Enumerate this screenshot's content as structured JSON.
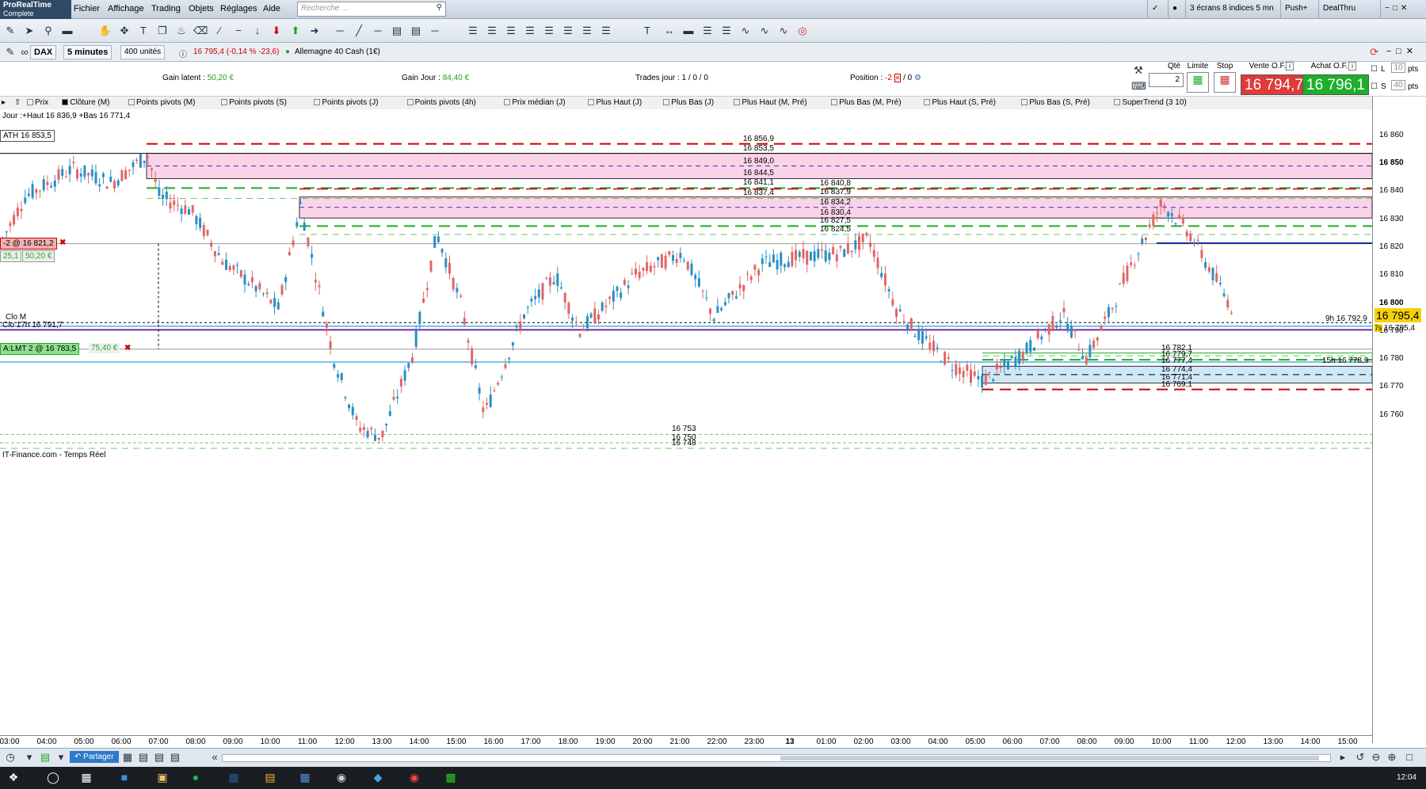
{
  "app": {
    "logo": "ProRealTime",
    "logo_sub": "Complete"
  },
  "menu": [
    "Fichier",
    "Affichage",
    "Trading",
    "Objets",
    "Réglages",
    "Aide"
  ],
  "search": {
    "placeholder": "Recherche ..."
  },
  "right_menu": {
    "layout": "3 écrans 8 indices 5 mn",
    "pushplus": "Push+",
    "dealthru": "DealThru"
  },
  "chart_bar": {
    "instrument": "DAX",
    "period": "5 minutes",
    "units": "400 unités",
    "quote": "16 795,4 (-0,14 % -23,6)",
    "market": "Allemagne 40 Cash (1€)"
  },
  "info": {
    "gain_latent_label": "Gain latent :",
    "gain_latent": "50,20 €",
    "gain_jour_label": "Gain Jour :",
    "gain_jour": "84,40 €",
    "trades_label": "Trades jour :",
    "trades": "1 / 0 / 0",
    "position_label": "Position :",
    "position": "-2",
    "position_extra": "/ 0"
  },
  "order": {
    "qte_label": "Qté",
    "qte": "2",
    "limite_label": "Limite",
    "stop_label": "Stop",
    "vente_label": "Vente O.F.",
    "vente": "16 794,7",
    "achat_label": "Achat O.F.",
    "achat": "16 796,1",
    "pts1": "10",
    "pts2": "40",
    "pts": "pts",
    "L": "L",
    "S": "S"
  },
  "indicators": [
    "Prix",
    "Clôture (M)",
    "Points pivots (M)",
    "Points pivots (S)",
    "Points pivots (J)",
    "Points pivots (4h)",
    "Prix médian (J)",
    "Plus Haut (J)",
    "Plus Bas (J)",
    "Plus Haut (M, Pré)",
    "Plus Bas (M, Pré)",
    "Plus Haut (S, Pré)",
    "Plus Bas (S, Pré)",
    "SuperTrend (3 10)"
  ],
  "chart_labels": {
    "jour": "Jour :+Haut 16 836,9 +Bas 16 771,4",
    "ath": "ATH 16 853,5",
    "position_tag": "-2 @ 16 821,2",
    "pos_pts": "25,1",
    "pos_gain": "50,20 €",
    "order_tag": "A:LMT 2 @ 16 783,5",
    "order_gain": "75,40 €",
    "clo_m": "Clo M",
    "clo_17h": "Clo 17h 16 791,7",
    "h9": "9h 16 792,9",
    "h15": "15h 16 778,9",
    "source": "IT-Finance.com - Temps Réel",
    "price_box": "16 795,4",
    "price_small": "16 795,4",
    "ts": "7s"
  },
  "levels": [
    {
      "v": "16 856,9"
    },
    {
      "v": "16 853,5"
    },
    {
      "v": "16 849,0"
    },
    {
      "v": "16 844,5"
    },
    {
      "v": "16 841,1"
    },
    {
      "v": "16 840,8"
    },
    {
      "v": "16 837,4"
    },
    {
      "v": "16 837,9"
    },
    {
      "v": "16 834,2"
    },
    {
      "v": "16 830,4"
    },
    {
      "v": "16 827,5"
    },
    {
      "v": "16 824,5"
    },
    {
      "v": "16 782,1"
    },
    {
      "v": "16 779,7"
    },
    {
      "v": "16 777,4"
    },
    {
      "v": "16 774,4"
    },
    {
      "v": "16 771,4"
    },
    {
      "v": "16 769,1"
    },
    {
      "v": "16 753"
    },
    {
      "v": "16 750"
    },
    {
      "v": "16 748"
    }
  ],
  "y_axis": [
    "16 860",
    "16 850",
    "16 840",
    "16 830",
    "16 820",
    "16 810",
    "16 800",
    "16 790",
    "16 780",
    "16 770",
    "16 760"
  ],
  "time_axis": [
    "03:00",
    "04:00",
    "05:00",
    "06:00",
    "07:00",
    "08:00",
    "09:00",
    "10:00",
    "11:00",
    "12:00",
    "13:00",
    "14:00",
    "15:00",
    "16:00",
    "17:00",
    "18:00",
    "19:00",
    "20:00",
    "21:00",
    "22:00",
    "23:00",
    "13",
    "01:00",
    "02:00",
    "03:00",
    "04:00",
    "05:00",
    "06:00",
    "07:00",
    "08:00",
    "09:00",
    "10:00",
    "11:00",
    "12:00",
    "13:00",
    "14:00",
    "15:00"
  ],
  "bottom": {
    "partager": "Partager"
  },
  "clock": "12:04",
  "colors": {
    "up": "#2a8fc4",
    "down": "#e06666",
    "zone": "#fbd3e6",
    "zone2": "#cfe8f8"
  }
}
